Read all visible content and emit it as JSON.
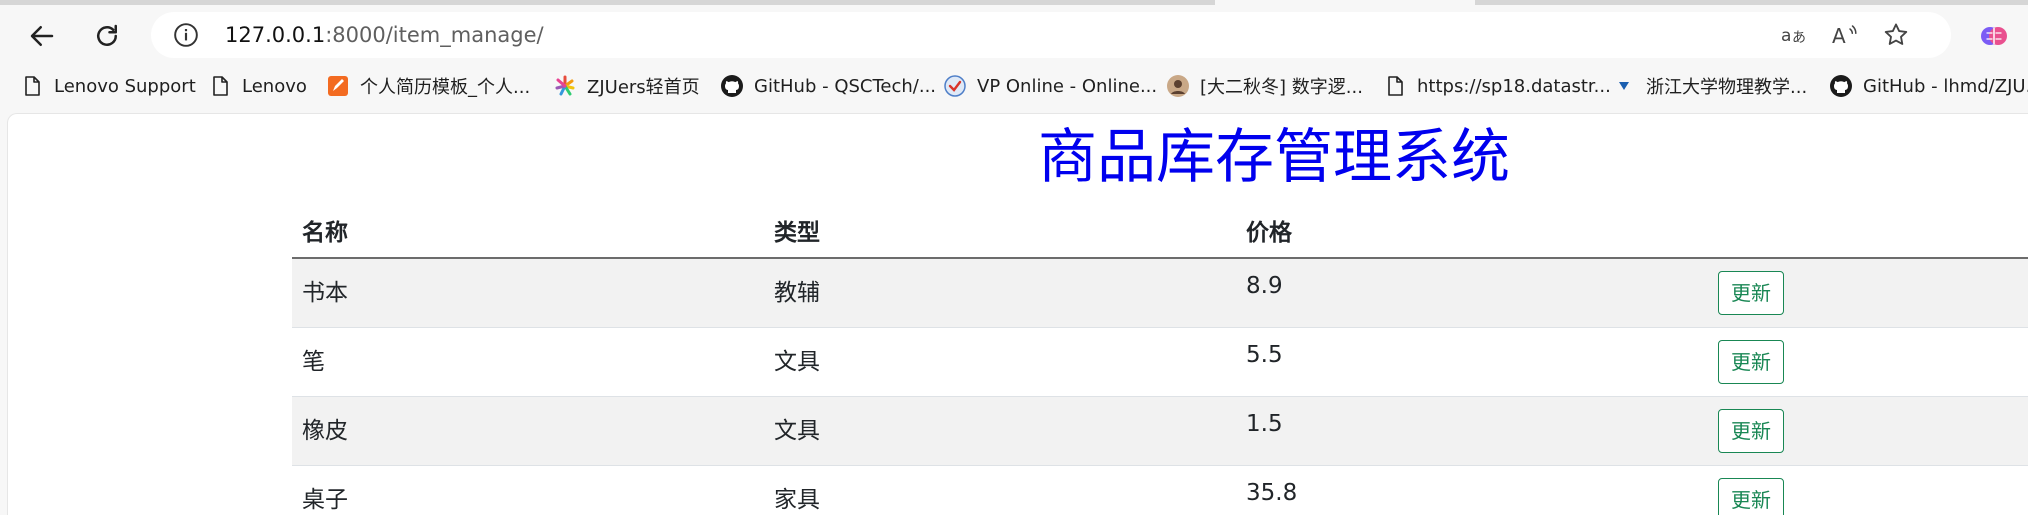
{
  "browser": {
    "address": {
      "host": "127.0.0.1",
      "rest": ":8000/item_manage/"
    },
    "bookmarks": [
      {
        "label": "Lenovo Support",
        "icon": "page-icon"
      },
      {
        "label": "Lenovo",
        "icon": "page-icon"
      },
      {
        "label": "个人简历模板_个人...",
        "icon": "resume-site-icon"
      },
      {
        "label": "ZJUers轻首页",
        "icon": "flower-icon"
      },
      {
        "label": "GitHub - QSCTech/...",
        "icon": "github-icon"
      },
      {
        "label": "VP Online - Online...",
        "icon": "vp-online-icon"
      },
      {
        "label": "[大二秋冬] 数字逻...",
        "icon": "avatar-icon"
      },
      {
        "label": "https://sp18.datastr...",
        "icon": "page-icon"
      },
      {
        "label": "浙江大学物理教学...",
        "icon": "triangle-icon"
      },
      {
        "label": "GitHub - lhmd/ZJU...",
        "icon": "github-icon"
      }
    ]
  },
  "page": {
    "title": "商品库存管理系统",
    "columns": [
      "名称",
      "类型",
      "价格"
    ],
    "rows": [
      {
        "name": "书本",
        "type": "教辅",
        "price": "8.9",
        "action": "更新"
      },
      {
        "name": "笔",
        "type": "文具",
        "price": "5.5",
        "action": "更新"
      },
      {
        "name": "橡皮",
        "type": "文具",
        "price": "1.5",
        "action": "更新"
      },
      {
        "name": "桌子",
        "type": "家具",
        "price": "35.8",
        "action": "更新"
      }
    ]
  },
  "colors": {
    "title": "#0000ee",
    "update_button": "#198754",
    "stripe": "#f2f2f2"
  }
}
